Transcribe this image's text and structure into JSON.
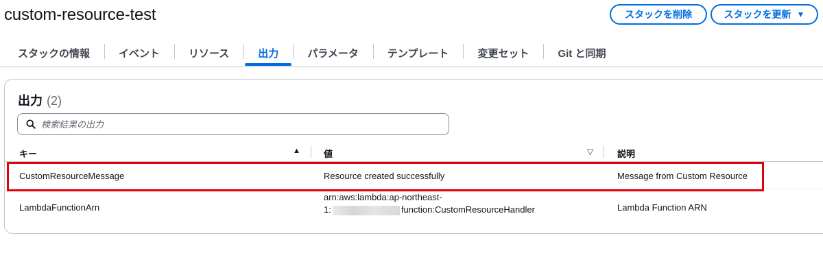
{
  "stack": {
    "title": "custom-resource-test"
  },
  "actions": {
    "delete_label": "スタックを削除",
    "update_label": "スタックを更新",
    "update_caret": "▼"
  },
  "tabs": [
    {
      "label": "スタックの情報",
      "active": false
    },
    {
      "label": "イベント",
      "active": false
    },
    {
      "label": "リソース",
      "active": false
    },
    {
      "label": "出力",
      "active": true
    },
    {
      "label": "パラメータ",
      "active": false
    },
    {
      "label": "テンプレート",
      "active": false
    },
    {
      "label": "変更セット",
      "active": false
    },
    {
      "label": "Git と同期",
      "active": false
    }
  ],
  "outputs": {
    "title": "出力",
    "count": "(2)",
    "search_placeholder": "検索結果の出力",
    "columns": {
      "key": "キー",
      "value": "値",
      "description": "説明"
    },
    "sort_asc_icon": "▲",
    "sort_none_icon": "▽",
    "rows": [
      {
        "key": "CustomResourceMessage",
        "value": "Resource created successfully",
        "description": "Message from Custom Resource"
      },
      {
        "key": "LambdaFunctionArn",
        "value_line1": "arn:aws:lambda:ap-northeast-",
        "value_line2_prefix": "1:",
        "value_line2_suffix": "function:CustomResourceHandler",
        "description": "Lambda Function ARN"
      }
    ]
  },
  "colors": {
    "accent": "#006ce0",
    "highlight_border": "#e1000b"
  }
}
